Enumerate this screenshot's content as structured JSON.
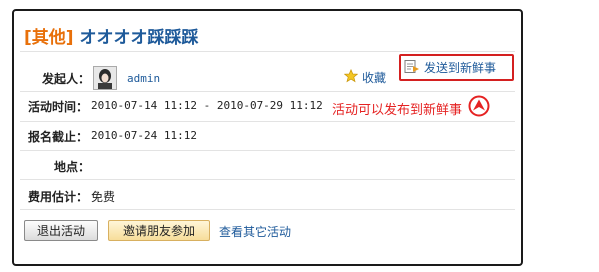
{
  "event": {
    "category": "[其他]",
    "title": "オオオオ踩踩踩"
  },
  "organizer": {
    "label": "发起人：",
    "username": "admin"
  },
  "actions": {
    "favorite_label": "收藏",
    "send_label": "发送到新鲜事"
  },
  "annotation": {
    "text": "活动可以发布到新鲜事"
  },
  "fields": {
    "time_label": "活动时间：",
    "time_value": "2010-07-14 11:12 - 2010-07-29 11:12",
    "deadline_label": "报名截止：",
    "deadline_value": "2010-07-24 11:12",
    "location_label": "地点：",
    "location_value": "",
    "cost_label": "费用估计：",
    "cost_value": "免费"
  },
  "buttons": {
    "exit_label": "退出活动",
    "invite_label": "邀请朋友参加",
    "other_label": "查看其它活动"
  },
  "colors": {
    "category": "#e8700a",
    "link": "#1e5a9a",
    "annotation": "#e52222",
    "highlight_border": "#d42020"
  }
}
